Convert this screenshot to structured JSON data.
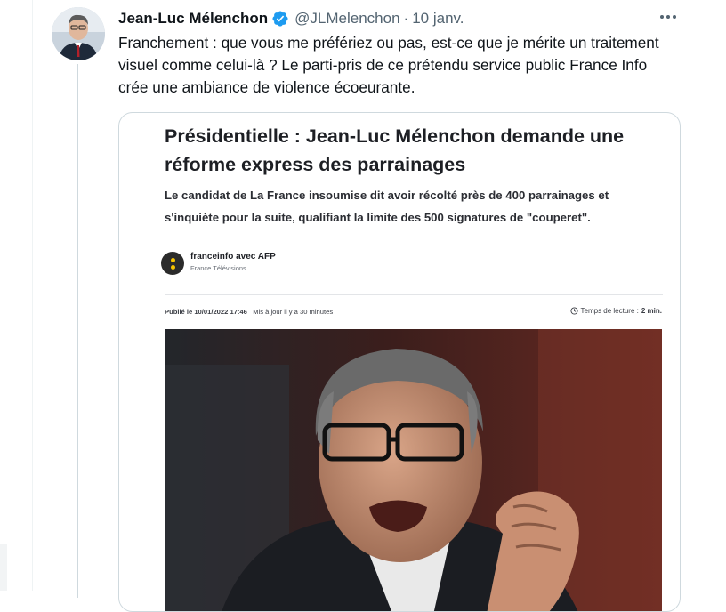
{
  "tweet": {
    "author_name": "Jean-Luc Mélenchon",
    "handle": "@JLMelenchon",
    "separator": "·",
    "date": "10 janv.",
    "text": "Franchement : que vous me préfériez ou pas, est-ce que je mérite un traitement visuel comme celui-là ? Le parti-pris de ce prétendu service public France Info crée une ambiance de violence écoeurante.",
    "verified_color": "#1d9bf0"
  },
  "card": {
    "headline": "Présidentielle : Jean-Luc Mélenchon demande une réforme express des parrainages",
    "lede": "Le candidat de La France insoumise dit avoir récolté près de 400 parrainages et s'inquiète pour la suite, qualifiant la limite des 500 signatures de \"couperet\".",
    "source_name": "franceinfo avec AFP",
    "source_sub": "France Télévisions",
    "published_label": "Publié le 10/01/2022 17:46",
    "updated_label": "Mis à jour il y a 30 minutes",
    "reading_label": "Temps de lecture :",
    "reading_value": "2 min."
  },
  "icons": {
    "more": "more-horizontal-icon",
    "verified": "verified-badge-icon",
    "clock": "clock-icon",
    "source_logo": "franceinfo-logo"
  }
}
